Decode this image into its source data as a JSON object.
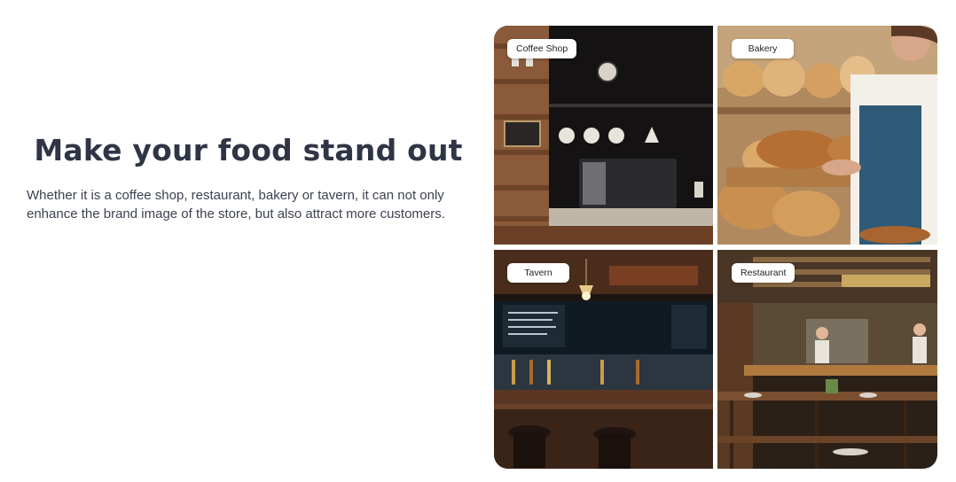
{
  "hero": {
    "title": "Make your food stand out",
    "description": "Whether it is a coffee shop, restaurant, bakery or tavern, it can not only enhance the brand image of the store, but also attract more customers."
  },
  "gallery": {
    "tiles": [
      {
        "label": "Coffee Shop"
      },
      {
        "label": "Bakery"
      },
      {
        "label": "Tavern"
      },
      {
        "label": "Restaurant"
      }
    ]
  }
}
